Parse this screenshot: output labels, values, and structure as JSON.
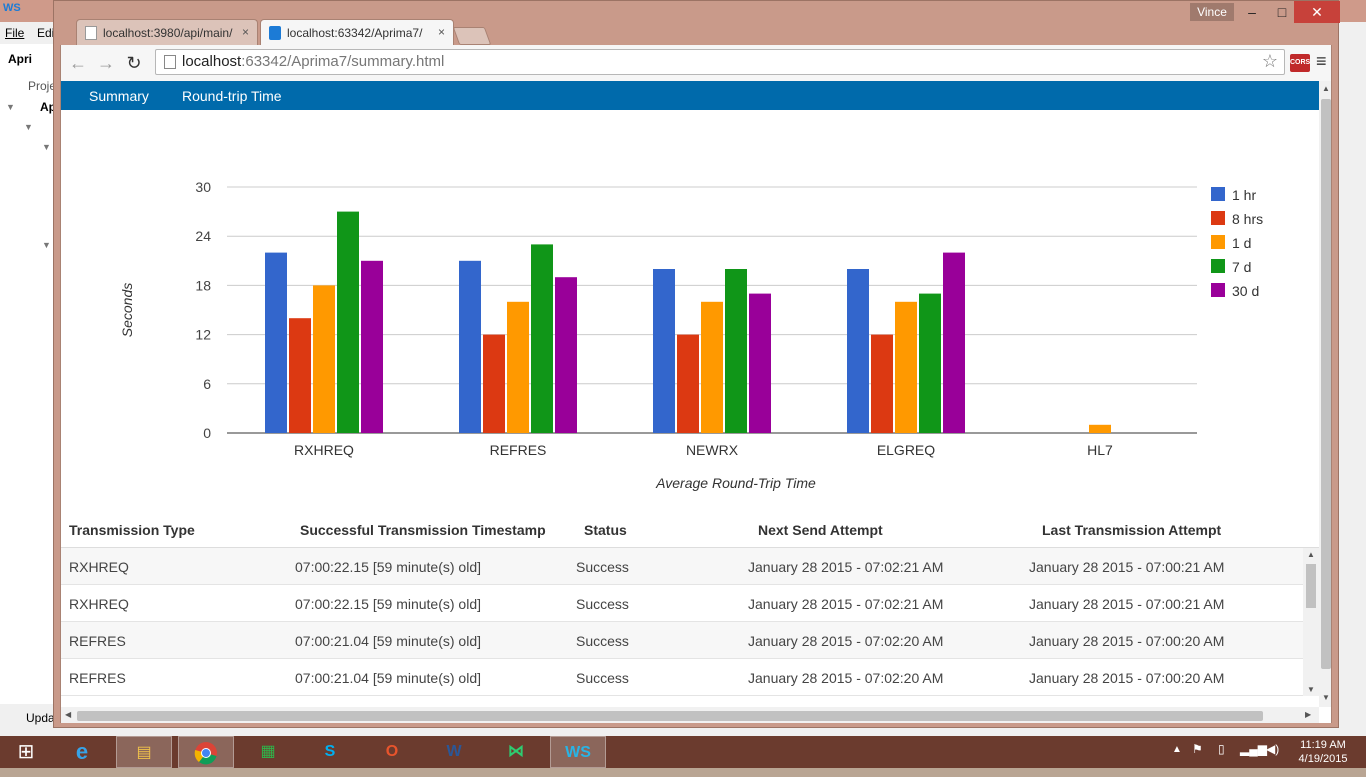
{
  "ide": {
    "menu_file": "File",
    "menu_edit": "Edi",
    "project_label": "Apri",
    "project_tab": "Proje",
    "tree_item": "Ap",
    "status_label": "Upda"
  },
  "window": {
    "user": "Vince",
    "minimize": "–",
    "maximize": "□",
    "close": "✕"
  },
  "tabs": [
    {
      "label": "localhost:3980/api/main/",
      "close": "×"
    },
    {
      "label": "localhost:63342/Aprima7/",
      "close": "×"
    }
  ],
  "address_bar": {
    "host": "localhost",
    "rest": ":63342/Aprima7/summary.html"
  },
  "extension": {
    "label": "CORS"
  },
  "nav": {
    "summary": "Summary",
    "roundtrip": "Round-trip Time"
  },
  "chart_data": {
    "type": "bar",
    "categories": [
      "RXHREQ",
      "REFRES",
      "NEWRX",
      "ELGREQ",
      "HL7"
    ],
    "series": [
      {
        "name": "1 hr",
        "color": "#3366cc",
        "values": [
          22,
          21,
          20,
          20,
          0
        ]
      },
      {
        "name": "8 hrs",
        "color": "#dc3912",
        "values": [
          14,
          12,
          12,
          12,
          0
        ]
      },
      {
        "name": "1 d",
        "color": "#ff9900",
        "values": [
          18,
          16,
          16,
          16,
          1
        ]
      },
      {
        "name": "7 d",
        "color": "#109618",
        "values": [
          27,
          23,
          20,
          17,
          0
        ]
      },
      {
        "name": "30 d",
        "color": "#990099",
        "values": [
          21,
          19,
          17,
          22,
          0
        ]
      }
    ],
    "ylim": [
      0,
      30
    ],
    "yticks": [
      0,
      6,
      12,
      18,
      24,
      30
    ],
    "ylabel": "Seconds",
    "xlabel": "Average Round-Trip Time",
    "legend": "right",
    "grid": true
  },
  "table": {
    "headers": {
      "type": "Transmission Type",
      "timestamp": "Successful Transmission Timestamp",
      "status": "Status",
      "next": "Next Send Attempt",
      "last": "Last Transmission Attempt"
    },
    "rows": [
      {
        "type": "RXHREQ",
        "timestamp": "07:00:22.15 [59 minute(s) old]",
        "status": "Success",
        "next": "January 28 2015 - 07:02:21 AM",
        "last": "January 28 2015 - 07:00:21 AM"
      },
      {
        "type": "RXHREQ",
        "timestamp": "07:00:22.15 [59 minute(s) old]",
        "status": "Success",
        "next": "January 28 2015 - 07:02:21 AM",
        "last": "January 28 2015 - 07:00:21 AM"
      },
      {
        "type": "REFRES",
        "timestamp": "07:00:21.04 [59 minute(s) old]",
        "status": "Success",
        "next": "January 28 2015 - 07:02:20 AM",
        "last": "January 28 2015 - 07:00:20 AM"
      },
      {
        "type": "REFRES",
        "timestamp": "07:00:21.04 [59 minute(s) old]",
        "status": "Success",
        "next": "January 28 2015 - 07:02:20 AM",
        "last": "January 28 2015 - 07:00:20 AM"
      }
    ]
  },
  "taskbar": {
    "time": "11:19 AM",
    "date": "4/19/2015"
  }
}
